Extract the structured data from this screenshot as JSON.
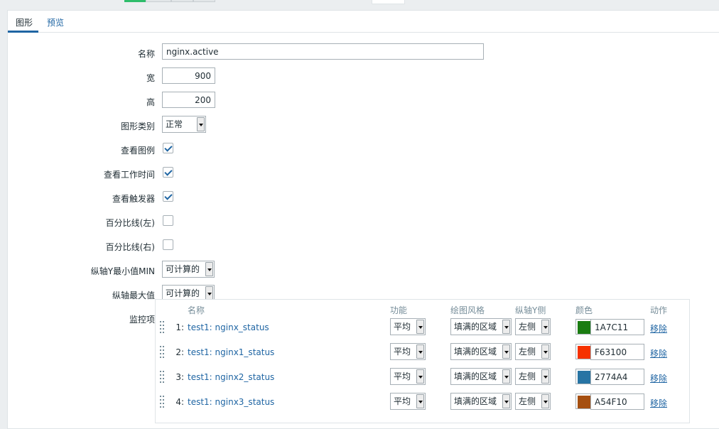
{
  "tabs": [
    {
      "label": "图形",
      "active": true
    },
    {
      "label": "预览",
      "active": false
    }
  ],
  "form": {
    "name_label": "名称",
    "name_value": "nginx.active",
    "width_label": "宽",
    "width_value": "900",
    "height_label": "高",
    "height_value": "200",
    "graph_type_label": "图形类别",
    "graph_type_value": "正常",
    "show_legend_label": "查看图例",
    "show_legend_checked": true,
    "show_work_period_label": "查看工作时间",
    "show_work_period_checked": true,
    "show_triggers_label": "查看触发器",
    "show_triggers_checked": true,
    "percentile_left_label": "百分比线(左)",
    "percentile_left_checked": false,
    "percentile_right_label": "百分比线(右)",
    "percentile_right_checked": false,
    "ymin_label": "纵轴Y最小值MIN",
    "ymin_value": "可计算的",
    "ymax_label": "纵轴最大值",
    "ymax_value": "可计算的",
    "items_label": "监控项"
  },
  "items_table": {
    "headers": {
      "name": "名称",
      "function": "功能",
      "draw_style": "绘图风格",
      "y_axis_side": "纵轴Y侧",
      "color": "颜色",
      "action": "动作"
    },
    "rows": [
      {
        "num": "1:",
        "name": "test1: nginx_status",
        "function": "平均",
        "draw_style": "填满的区域",
        "y_axis_side": "左侧",
        "color_hex": "1A7C11",
        "color": "#1A7C11",
        "action": "移除"
      },
      {
        "num": "2:",
        "name": "test1: nginx1_status",
        "function": "平均",
        "draw_style": "填满的区域",
        "y_axis_side": "左侧",
        "color_hex": "F63100",
        "color": "#F63100",
        "action": "移除"
      },
      {
        "num": "3:",
        "name": "test1: nginx2_status",
        "function": "平均",
        "draw_style": "填满的区域",
        "y_axis_side": "左侧",
        "color_hex": "2774A4",
        "color": "#2774A4",
        "action": "移除"
      },
      {
        "num": "4:",
        "name": "test1: nginx3_status",
        "function": "平均",
        "draw_style": "填满的区域",
        "y_axis_side": "左侧",
        "color_hex": "A54F10",
        "color": "#A54F10",
        "action": "移除"
      }
    ]
  },
  "colors": {
    "accent": "#1f65a3",
    "active_segment": "#2ebd6b"
  }
}
